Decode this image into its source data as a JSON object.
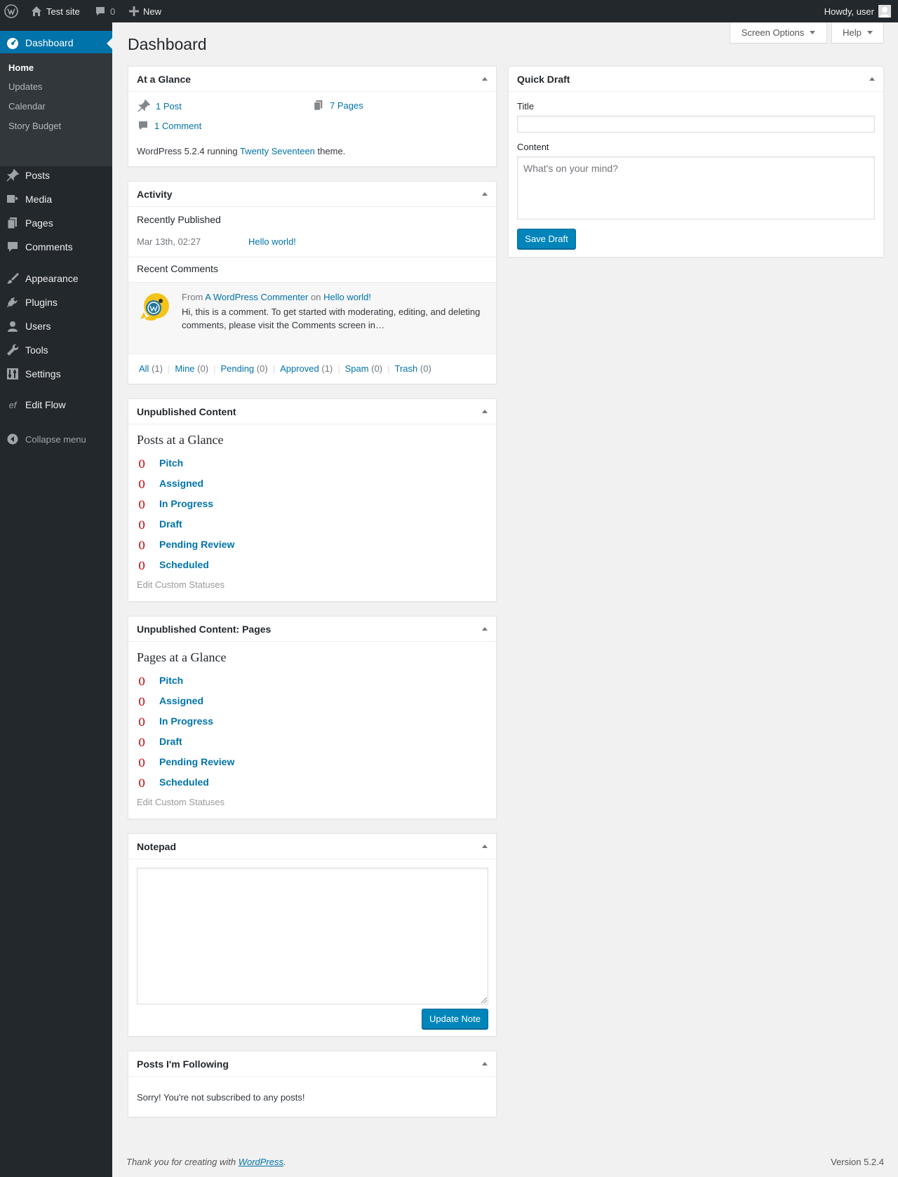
{
  "adminbar": {
    "site_name": "Test site",
    "comments_count": "0",
    "new_label": "New",
    "howdy": "Howdy, user"
  },
  "sidebar": {
    "dashboard": "Dashboard",
    "submenu": [
      "Home",
      "Updates",
      "Calendar",
      "Story Budget"
    ],
    "items": [
      "Posts",
      "Media",
      "Pages",
      "Comments",
      "Appearance",
      "Plugins",
      "Users",
      "Tools",
      "Settings",
      "Edit Flow"
    ],
    "collapse": "Collapse menu"
  },
  "header": {
    "title": "Dashboard",
    "screen_options": "Screen Options",
    "help": "Help"
  },
  "at_a_glance": {
    "title": "At a Glance",
    "posts": "1 Post",
    "pages": "7 Pages",
    "comments": "1 Comment",
    "wp_text": "WordPress 5.2.4 running",
    "theme": "Twenty Seventeen",
    "theme_suffix": "theme."
  },
  "activity": {
    "title": "Activity",
    "recently_published": "Recently Published",
    "pub_date": "Mar 13th, 02:27",
    "pub_title": "Hello world!",
    "recent_comments": "Recent Comments",
    "from": "From",
    "commenter": "A WordPress Commenter",
    "on": "on",
    "comment_post": "Hello world!",
    "comment_text": "Hi, this is a comment. To get started with moderating, editing, and deleting comments, please visit the Comments screen in…",
    "filters": [
      {
        "label": "All",
        "count": "(1)"
      },
      {
        "label": "Mine",
        "count": "(0)"
      },
      {
        "label": "Pending",
        "count": "(0)"
      },
      {
        "label": "Approved",
        "count": "(1)"
      },
      {
        "label": "Spam",
        "count": "(0)"
      },
      {
        "label": "Trash",
        "count": "(0)"
      }
    ]
  },
  "unpublished": {
    "title": "Unpublished Content",
    "subtitle": "Posts at a Glance",
    "statuses": [
      {
        "count": "0",
        "label": "Pitch"
      },
      {
        "count": "0",
        "label": "Assigned"
      },
      {
        "count": "0",
        "label": "In Progress"
      },
      {
        "count": "0",
        "label": "Draft"
      },
      {
        "count": "0",
        "label": "Pending Review"
      },
      {
        "count": "0",
        "label": "Scheduled"
      }
    ],
    "edit": "Edit Custom Statuses"
  },
  "unpublished_pages": {
    "title": "Unpublished Content: Pages",
    "subtitle": "Pages at a Glance",
    "statuses": [
      {
        "count": "0",
        "label": "Pitch"
      },
      {
        "count": "0",
        "label": "Assigned"
      },
      {
        "count": "0",
        "label": "In Progress"
      },
      {
        "count": "0",
        "label": "Draft"
      },
      {
        "count": "0",
        "label": "Pending Review"
      },
      {
        "count": "0",
        "label": "Scheduled"
      }
    ],
    "edit": "Edit Custom Statuses"
  },
  "notepad": {
    "title": "Notepad",
    "button": "Update Note"
  },
  "following": {
    "title": "Posts I'm Following",
    "message": "Sorry! You're not subscribed to any posts!"
  },
  "quick_draft": {
    "title": "Quick Draft",
    "title_label": "Title",
    "content_label": "Content",
    "content_placeholder": "What's on your mind?",
    "button": "Save Draft"
  },
  "footer": {
    "thanks": "Thank you for creating with",
    "wordpress": "WordPress",
    "period": ".",
    "version": "Version 5.2.4"
  }
}
